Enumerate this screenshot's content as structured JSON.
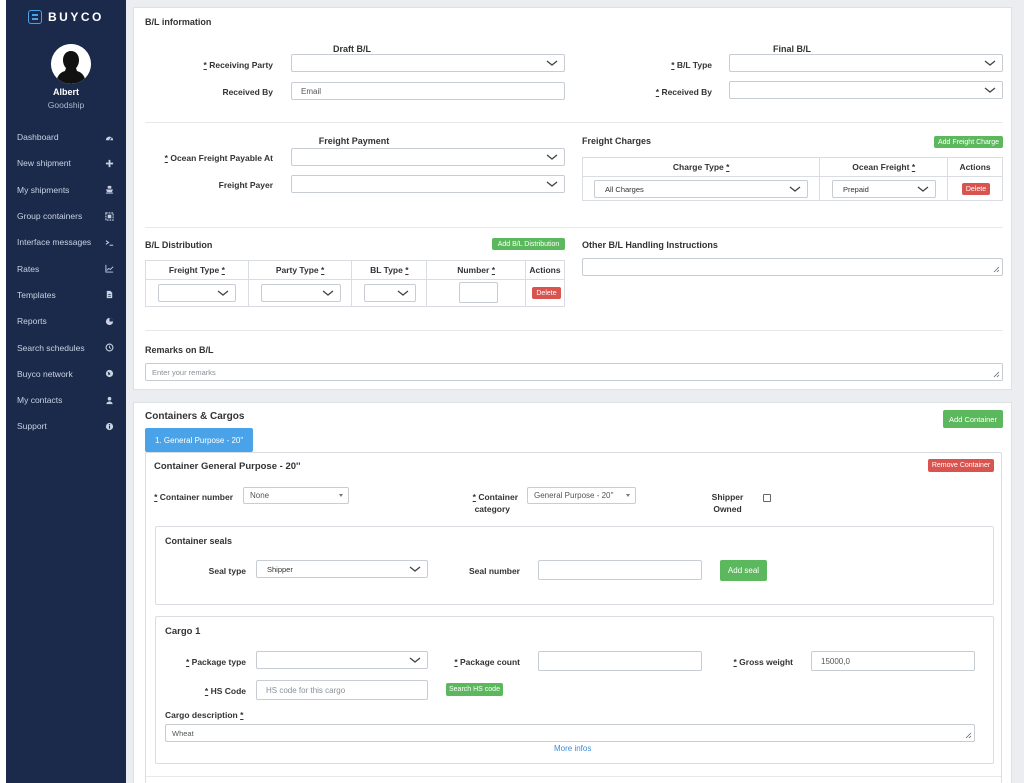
{
  "sidebar": {
    "logo": "BUYCO",
    "user_name": "Albert",
    "user_company": "Goodship",
    "items": [
      {
        "label": "Dashboard",
        "icon": "dashboard-icon"
      },
      {
        "label": "New shipment",
        "icon": "plus-icon"
      },
      {
        "label": "My shipments",
        "icon": "ship-icon"
      },
      {
        "label": "Group containers",
        "icon": "group-icon"
      },
      {
        "label": "Interface messages",
        "icon": "terminal-icon"
      },
      {
        "label": "Rates",
        "icon": "chart-icon"
      },
      {
        "label": "Templates",
        "icon": "file-icon"
      },
      {
        "label": "Reports",
        "icon": "pie-icon"
      },
      {
        "label": "Search schedules",
        "icon": "clock-icon"
      },
      {
        "label": "Buyco network",
        "icon": "globe-icon"
      },
      {
        "label": "My contacts",
        "icon": "user-icon"
      },
      {
        "label": "Support",
        "icon": "info-icon"
      }
    ]
  },
  "bl": {
    "title": "B/L information",
    "draft_heading": "Draft B/L",
    "final_heading": "Final B/L",
    "receiving_party_label": "Receiving Party",
    "received_by_label": "Received By",
    "received_by_value": "Email",
    "bl_type_label": "B/L Type",
    "final_received_by_label": "Received By",
    "req": "*"
  },
  "freight": {
    "payment_heading": "Freight Payment",
    "payable_at_label": "Ocean Freight Payable At",
    "payer_label": "Freight Payer",
    "charges_title": "Freight Charges",
    "add_charge_btn": "Add Freight Charge",
    "col_charge_type": "Charge Type",
    "col_ocean_freight": "Ocean Freight",
    "col_actions": "Actions",
    "charge_type_value": "All Charges",
    "ocean_freight_value": "Prepaid",
    "delete_btn": "Delete"
  },
  "distribution": {
    "title": "B/L Distribution",
    "add_btn": "Add B/L Distribution",
    "col_freight_type": "Freight Type",
    "col_party_type": "Party Type",
    "col_bl_type": "BL Type",
    "col_number": "Number",
    "col_actions": "Actions",
    "delete_btn": "Delete"
  },
  "other": {
    "title": "Other B/L Handling Instructions"
  },
  "remarks": {
    "title": "Remarks on B/L",
    "placeholder": "Enter your remarks"
  },
  "containers": {
    "title": "Containers & Cargos",
    "add_btn": "Add Container",
    "tab_label": "1. General Purpose - 20''",
    "container_title": "Container General Purpose - 20''",
    "remove_btn": "Remove Container",
    "number_label": "Container number",
    "number_value": "None",
    "category_label_1": "Container",
    "category_label_2": "category",
    "category_value": "General Purpose - 20''",
    "shipper_label_1": "Shipper",
    "shipper_label_2": "Owned",
    "seals_title": "Container seals",
    "seal_type_label": "Seal type",
    "seal_type_value": "Shipper",
    "seal_number_label": "Seal number",
    "add_seal_btn": "Add seal"
  },
  "cargo": {
    "title": "Cargo 1",
    "package_type_label": "Package type",
    "package_count_label": "Package count",
    "gross_weight_label": "Gross weight",
    "gross_weight_value": "15000,0",
    "hs_code_label": "HS Code",
    "hs_code_placeholder": "HS code for this cargo",
    "search_hs_btn": "Search HS code",
    "description_label": "Cargo description",
    "description_value": "Wheat",
    "more_infos": "More infos"
  }
}
